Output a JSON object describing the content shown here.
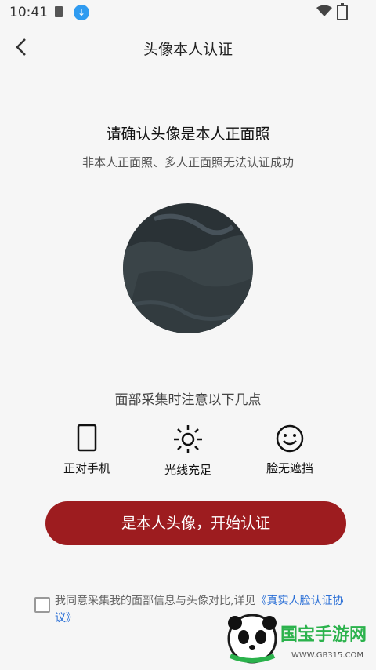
{
  "status": {
    "time": "10:41"
  },
  "header": {
    "title": "头像本人认证"
  },
  "main": {
    "heading": "请确认头像是本人正面照",
    "subheading": "非本人正面照、多人正面照无法认证成功",
    "tips_title": "面部采集时注意以下几点",
    "tips": [
      {
        "label": "正对手机",
        "icon": "phone-icon"
      },
      {
        "label": "光线充足",
        "icon": "sun-icon"
      },
      {
        "label": "脸无遮挡",
        "icon": "smile-icon"
      }
    ],
    "cta_label": "是本人头像，开始认证"
  },
  "agreement": {
    "text": "我同意采集我的面部信息与头像对比,详见",
    "link": "《真实人脸认证协议》"
  },
  "watermark": {
    "brand": "国宝手游网",
    "url": "WWW.GB315.COM"
  },
  "colors": {
    "accent": "#9d1c1f",
    "link": "#2a6fd6"
  }
}
